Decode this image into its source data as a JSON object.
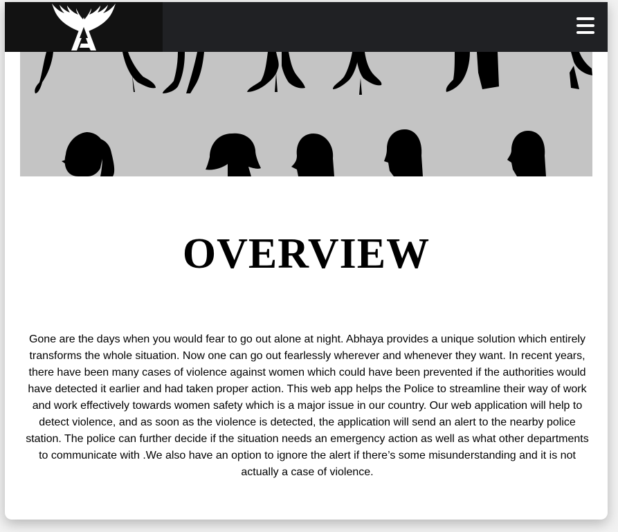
{
  "navbar": {
    "logo_icon": "winged-a-logo-icon",
    "menu_icon": "hamburger-menu-icon"
  },
  "hero": {
    "image_description_icon": "women-silhouettes-banner"
  },
  "overview": {
    "title": "OVERVIEW",
    "body": "Gone are the days when you would fear to go out alone at night. Abhaya provides a unique solution which entirely transforms the whole situation. Now one can go out fearlessly wherever and whenever they want. In recent years, there have been many cases of violence against women which could have been prevented if the authorities would have detected it earlier and had taken proper action. This web app helps the Police to streamline their way of work and work effectively towards women safety which is a major issue in our country. Our web application will help to detect violence, and as soon as the violence is detected, the application will send an alert to the nearby police station. The police can further decide if the situation needs an emergency action as well as what other departments to communicate with .We also have an option to ignore the alert if there’s some misunderstanding and it is not actually a case of violence."
  },
  "colors": {
    "navbar_bg": "#202124",
    "logo_bg": "#121212",
    "hero_bg": "#c4c4c4",
    "text": "#000000"
  }
}
